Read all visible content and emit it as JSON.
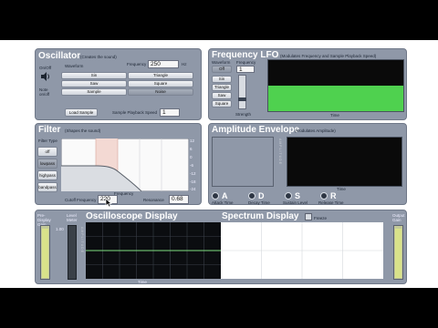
{
  "oscillator": {
    "title": "Oscillator",
    "subtitle": "(Creates the sound)",
    "on_off": "On/Off",
    "note_on": "Note on/off",
    "waveform_label": "Waveform",
    "frequency_label": "Frequency",
    "frequency_value": "250",
    "frequency_unit": "Hz",
    "wave_buttons": [
      "Sin",
      "Triangle",
      "Saw",
      "Square",
      "Sample",
      "Noise"
    ],
    "load_sample": "Load Sample",
    "playback_label": "Sample Playback Speed",
    "playback_value": "1"
  },
  "lfo": {
    "title": "Frequency LFO",
    "subtitle": "(Modulates Frequency and Sample Playback Speed)",
    "off_label": "Off",
    "waveform_label": "Waveform",
    "frequency_label": "Frequency",
    "frequency_value": "1",
    "wave_buttons": [
      "Sin",
      "Triangle",
      "Saw",
      "Square"
    ],
    "strength_label": "Strength",
    "time_label": "Time",
    "amp_label": "AMPLITUDE",
    "display_fill": 0.5
  },
  "filter": {
    "title": "Filter",
    "subtitle": "(Shapes the sound)",
    "type_label": "Filter Type",
    "type_buttons": [
      "off",
      "lowpass",
      "highpass",
      "bandpass"
    ],
    "cutoff_label": "Cutoff Frequency",
    "cutoff_value": "220",
    "resonance_label": "Resonance",
    "resonance_value": "0.68",
    "freq_axis_label": "Frequency",
    "db_ticks": [
      "12",
      "6",
      "0",
      "-6",
      "-12",
      "-18",
      "-24"
    ]
  },
  "envelope": {
    "title": "Amplitude Envelope",
    "subtitle": "(Modulates Amplitude)",
    "time_label": "Time",
    "amp_label": "AMPLITUDE",
    "params": [
      {
        "letter": "A",
        "label": "Attack Time"
      },
      {
        "letter": "D",
        "label": "Decay Time"
      },
      {
        "letter": "S",
        "label": "Sustain Level"
      },
      {
        "letter": "R",
        "label": "Release Time"
      }
    ]
  },
  "bottom": {
    "pre_display_label": "Pre-Display Gain",
    "level_meter_label": "Level Meter",
    "meter_value": "1.00",
    "oscilloscope_title": "Oscilloscope Display",
    "spectrum_title": "Spectrum Display",
    "freeze_label": "Freeze",
    "output_label": "Output Gain",
    "amp_label": "AMPLITUDE",
    "time_label": "Time"
  }
}
